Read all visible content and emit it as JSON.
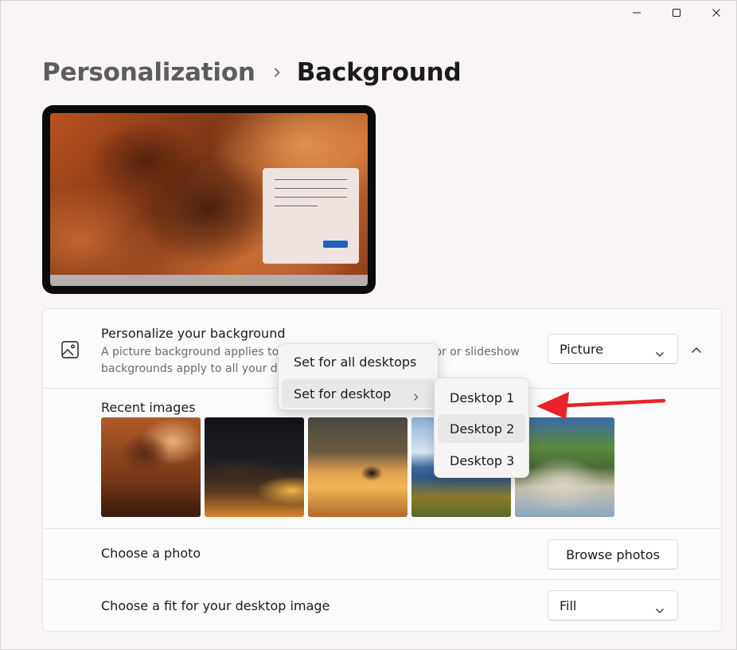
{
  "window": {
    "controls": {
      "minimize": "minimize-icon",
      "maximize": "maximize-icon",
      "close": "close-icon"
    }
  },
  "breadcrumb": {
    "parent": "Personalization",
    "current": "Background"
  },
  "background_row": {
    "title": "Personalize your background",
    "description_line1": "A picture background applies to ",
    "description_line1_end": "olor or slideshow",
    "description_line2": "backgrounds apply to all your de",
    "dropdown_value": "Picture"
  },
  "recent": {
    "title": "Recent images",
    "thumbnails": [
      "storm-clouds-lightning",
      "night-clouds-moon",
      "rhino-in-water-sunset",
      "lake-blue-sky",
      "granite-boulders-beach"
    ]
  },
  "choose_photo": {
    "label": "Choose a photo",
    "button": "Browse photos"
  },
  "choose_fit": {
    "label": "Choose a fit for your desktop image",
    "value": "Fill"
  },
  "context_menu": {
    "items": [
      {
        "label": "Set for all desktops"
      },
      {
        "label": "Set for desktop"
      }
    ]
  },
  "submenu": {
    "items": [
      {
        "label": "Desktop 1"
      },
      {
        "label": "Desktop 2"
      },
      {
        "label": "Desktop 3"
      }
    ]
  },
  "colors": {
    "accent": "#1f63b8",
    "annotation": "#e8232a"
  }
}
